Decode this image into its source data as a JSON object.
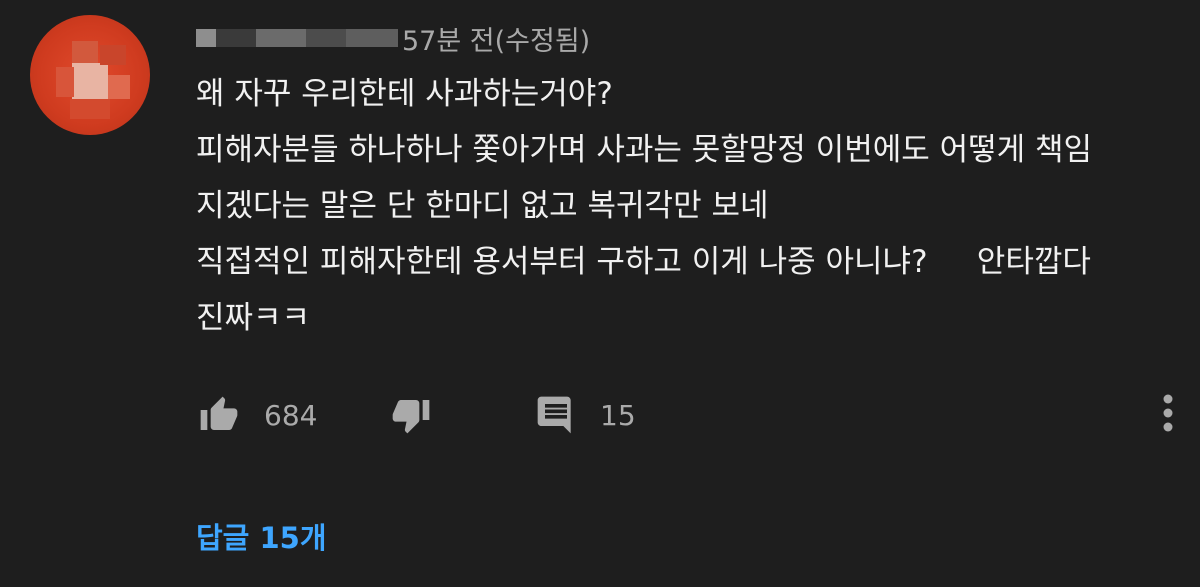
{
  "comment": {
    "timestamp": "57분 전(수정됨)",
    "lines": [
      "왜 자꾸 우리한테 사과하는거야?",
      "피해자분들 하나하나 쫓아가며 사과는 못할망정 이번에도 어떻게 책임",
      "지겠다는 말은 단 한마디 없고 복귀각만 보네",
      "직접적인 피해자한테 용서부터 구하고 이게 나중 아니냐?     안타깝다",
      "진짜ㅋㅋ"
    ],
    "like_count": "684",
    "reply_count": "15",
    "replies_link": "답글 15개"
  },
  "icons": {
    "like": "thumbs-up-icon",
    "dislike": "thumbs-down-icon",
    "reply": "comment-icon",
    "more": "more-vertical-icon"
  },
  "colors": {
    "background": "#1e1e1e",
    "text": "#f1f1f1",
    "secondary_text": "#aaaaaa",
    "link": "#3ea6ff",
    "avatar": "#d9432a"
  }
}
